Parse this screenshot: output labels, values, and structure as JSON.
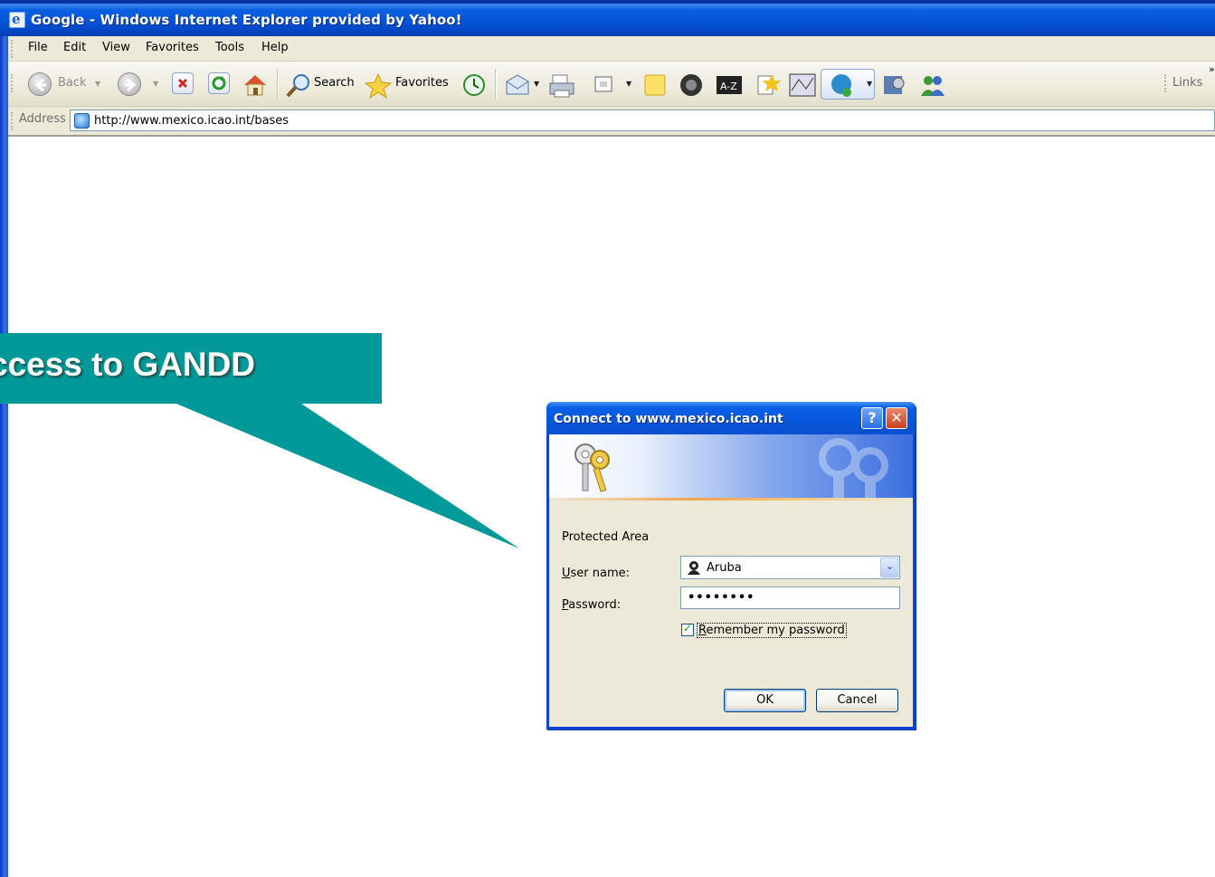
{
  "window": {
    "title": "Google - Windows Internet Explorer provided by Yahoo!"
  },
  "menubar": {
    "items": [
      "File",
      "Edit",
      "View",
      "Favorites",
      "Tools",
      "Help"
    ]
  },
  "toolbar": {
    "back_label": "Back",
    "search_label": "Search",
    "favorites_label": "Favorites",
    "links_label": "Links",
    "icons": [
      "back-arrow",
      "forward-arrow",
      "stop",
      "refresh",
      "home",
      "search",
      "favorites-star",
      "history",
      "mail",
      "print",
      "edit",
      "notes",
      "messenger",
      "encyclopedia",
      "research",
      "map",
      "messenger-app",
      "dictionary",
      "people"
    ]
  },
  "addressbar": {
    "label": "Address",
    "url": "http://www.mexico.icao.int/bases"
  },
  "callout": {
    "text": "ccess to GANDD",
    "color": "#009999"
  },
  "dialog": {
    "title": "Connect to www.mexico.icao.int",
    "help_glyph": "?",
    "close_glyph": "✕",
    "realm": "Protected Area",
    "username_label_first": "U",
    "username_label_rest": "ser name:",
    "username_value": "Aruba",
    "password_label_first": "P",
    "password_label_rest": "assword:",
    "password_value": "••••••••",
    "remember_label_first": "R",
    "remember_label_rest": "emember my password",
    "remember_checked": true,
    "ok_label": "OK",
    "cancel_label": "Cancel"
  },
  "colors": {
    "titlebar_blue": "#0554d8",
    "chrome_beige": "#ece9d8",
    "callout_teal": "#009999"
  }
}
